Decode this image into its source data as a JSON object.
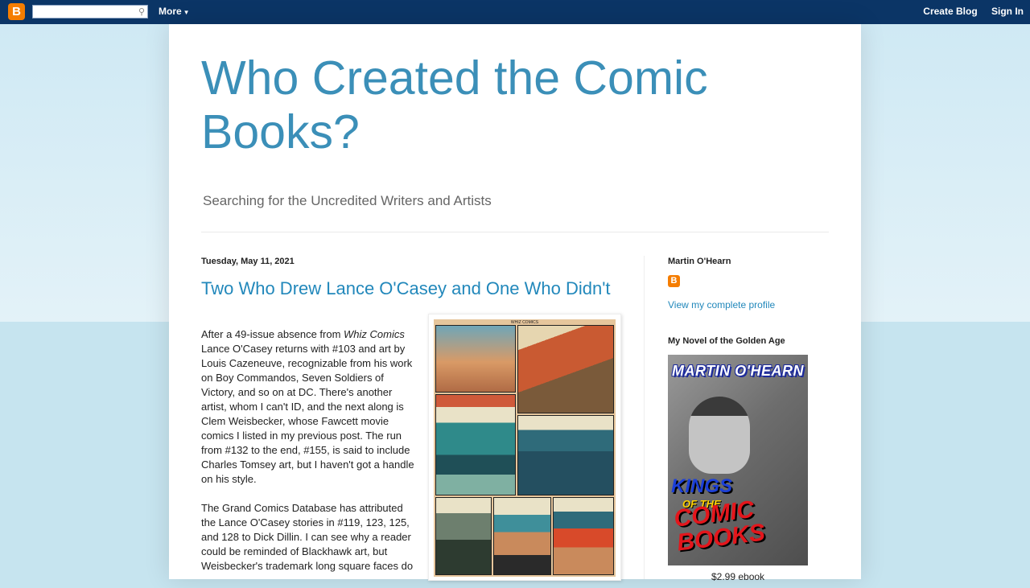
{
  "navbar": {
    "logo": "B",
    "search_value": "",
    "search_icon": "magnifier",
    "more_label": "More",
    "create_blog": "Create Blog",
    "sign_in": "Sign In"
  },
  "header": {
    "title": "Who Created the Comic Books?",
    "description": "Searching for the Uncredited Writers and Artists"
  },
  "post": {
    "date": "Tuesday, May 11, 2021",
    "title": "Two Who Drew Lance O'Casey and One Who Didn't",
    "p1_a": "After a 49-issue absence from ",
    "p1_em": "Whiz Comics",
    "p1_b": " Lance O'Casey returns with #103 and art by Louis Cazeneuve, recognizable from his work on Boy Commandos, Seven Soldiers of Victory, and so on at DC. There's another artist, whom I can't ID, and the next along is Clem Weisbecker, whose Fawcett movie comics I listed in my previous post. The run from #132 to the end, #155, is said to include Charles Tomsey art, but I haven't got a handle on his style.",
    "p2": "The Grand Comics Database has attributed the Lance O'Casey stories in #119, 123, 125, and 128 to Dick Dillin. I can see why a reader could be reminded of Blackhawk art, but Weisbecker's trademark long square faces do",
    "image_caption": "WHIZ COMICS"
  },
  "sidebar": {
    "profile_heading": "Martin O'Hearn",
    "profile_icon": "B",
    "profile_link": "View my complete profile",
    "novel_heading": "My Novel of the Golden Age",
    "book": {
      "author": "MARTIN O'HEARN",
      "title_1": "KINGS",
      "title_2": "OF THE",
      "title_3": "COMIC BOOKS"
    },
    "price": "$2.99 ebook"
  },
  "colors": {
    "navbar_bg": "#0b3566",
    "title_color": "#3b8fb8",
    "link_color": "#2288bb",
    "blogger_orange": "#f57d00"
  }
}
